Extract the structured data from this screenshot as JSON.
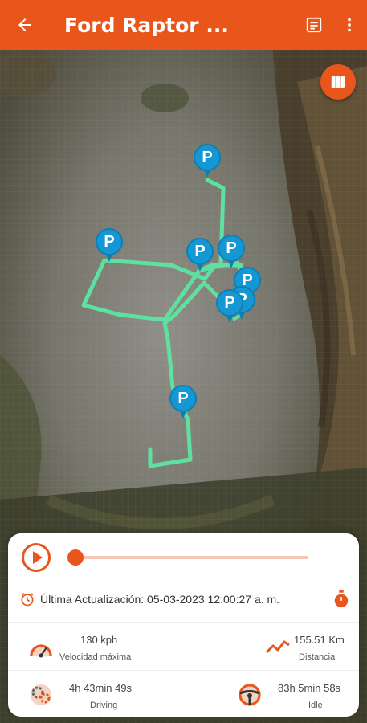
{
  "header": {
    "title": "Ford Raptor ...",
    "back_icon": "arrow-left-icon",
    "report_icon": "article-icon",
    "more_icon": "more-vert-icon"
  },
  "map": {
    "map_type_icon": "map-icon",
    "parking_label": "P",
    "parking_marker_count": 8,
    "route_color": "#5de0a0",
    "marker_color": "#1597d3"
  },
  "player": {
    "play_icon": "play-icon",
    "progress": 0.0
  },
  "update": {
    "icon": "clock-refresh-icon",
    "text": "Última Actualización: 05-03-2023 12:00:27 a. m.",
    "timer_icon": "stopwatch-icon"
  },
  "stats": {
    "max_speed": {
      "value": "130 kph",
      "label": "Velocidad máxima",
      "icon": "speedometer-icon"
    },
    "distance": {
      "value": "155.51 Km",
      "label": "Distancia",
      "icon": "trend-line-icon"
    },
    "driving": {
      "value": "4h 43min 49s",
      "label": "Driving",
      "icon": "gears-icon"
    },
    "idle": {
      "value": "83h 5min 58s",
      "label": "Idle",
      "icon": "steering-wheel-icon"
    }
  },
  "colors": {
    "accent": "#e9561c"
  }
}
